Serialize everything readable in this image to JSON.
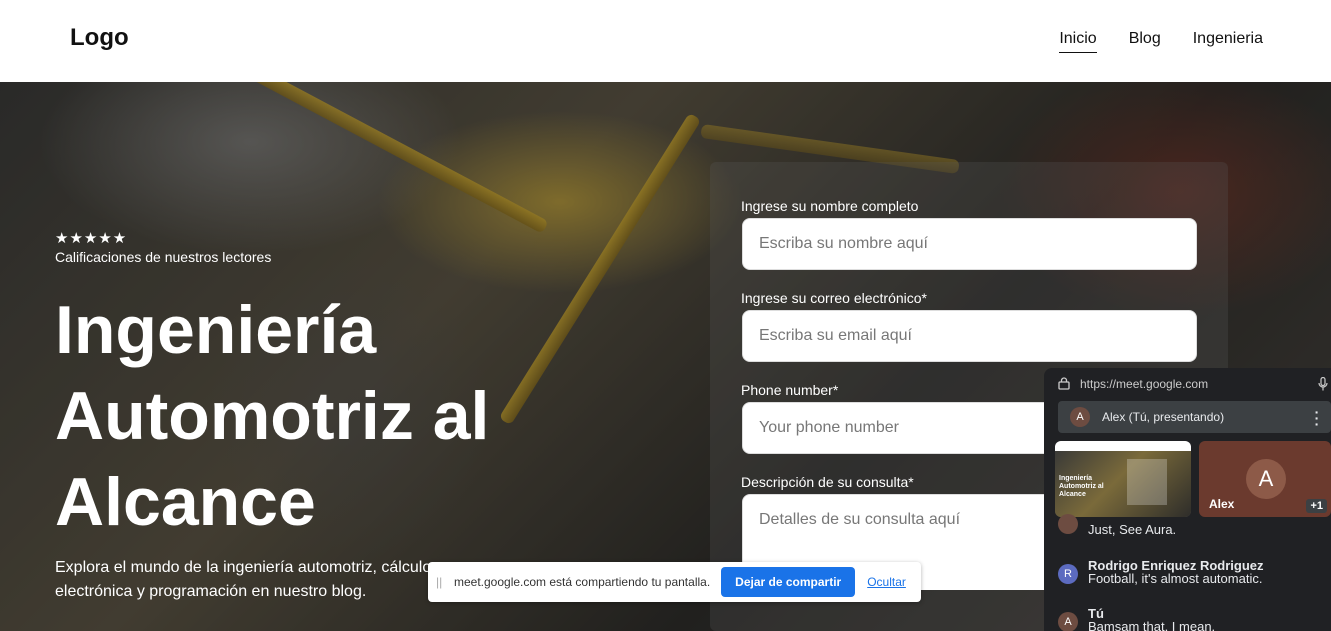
{
  "header": {
    "logo": "Logo",
    "nav": [
      {
        "label": "Inicio",
        "active": true
      },
      {
        "label": "Blog",
        "active": false
      },
      {
        "label": "Ingenieria",
        "active": false
      }
    ]
  },
  "hero": {
    "rating_stars": "★★★★★",
    "rating_label": "Calificaciones de nuestros lectores",
    "title": "Ingeniería Automotriz al Alcance",
    "description": "Explora el mundo de la ingeniería automotriz, cálculo electrónica y programación en nuestro blog."
  },
  "form": {
    "name_label": "Ingrese su nombre completo",
    "name_placeholder": "Escriba su nombre aquí",
    "email_label": "Ingrese su correo electrónico*",
    "email_placeholder": "Escriba su email aquí",
    "phone_label": "Phone number*",
    "phone_placeholder": "Your phone number",
    "description_label": "Descripción de su consulta*",
    "description_placeholder": "Detalles de su consulta aquí"
  },
  "share_bar": {
    "message": "meet.google.com está compartiendo tu pantalla.",
    "stop_label": "Dejar de compartir",
    "hide_label": "Ocultar"
  },
  "meet": {
    "url": "https://meet.google.com",
    "presenter": "Alex (Tú, presentando)",
    "presenter_initial": "A",
    "screen_tile_title": "Ingeniería Automotriz al Alcance",
    "camera_name": "Alex",
    "camera_initial": "A",
    "extra_count": "+1",
    "chat": [
      {
        "name": "",
        "text": "Just, See Aura.",
        "initial": "",
        "color": "#6d4c41"
      },
      {
        "name": "Rodrigo Enriquez Rodriguez",
        "text": "Football, it's almost automatic.",
        "initial": "R",
        "color": "#5c6bc0"
      },
      {
        "name": "Tú",
        "text": "Bamsam that, I mean.",
        "initial": "A",
        "color": "#6d4c41"
      }
    ]
  }
}
